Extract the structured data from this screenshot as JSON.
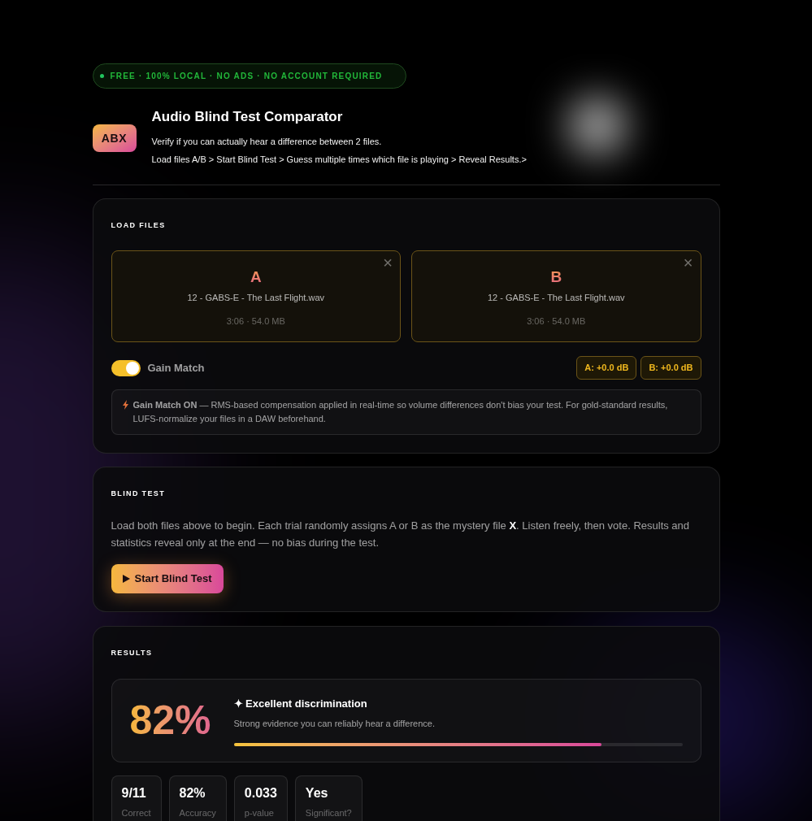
{
  "badge": {
    "text": "FREE · 100% LOCAL · NO ADS · NO ACCOUNT REQUIRED"
  },
  "header": {
    "logo": "ABX",
    "title": "Audio Blind Test Comparator",
    "subtitle": "Verify if you can actually hear a difference between 2 files.",
    "steps": "Load files A/B > Start Blind Test > Guess multiple times which file is playing > Reveal Results.>"
  },
  "load_files": {
    "heading": "LOAD FILES",
    "files": [
      {
        "letter": "A",
        "name": "12 - GABS-E - The Last Flight.wav",
        "meta": "3:06 · 54.0 MB",
        "close": "×"
      },
      {
        "letter": "B",
        "name": "12 - GABS-E - The Last Flight.wav",
        "meta": "3:06 · 54.0 MB",
        "close": "×"
      }
    ],
    "gain_match": {
      "label": "Gain Match",
      "on": true
    },
    "gains": [
      "A: +0.0 dB",
      "B: +0.0 dB"
    ],
    "note": "**Gain Match ON** — RMS-based compensation applied in real-time so volume differences don't bias your test. For gold-standard results, LUFS-normalize your files in a DAW beforehand."
  },
  "blind_test": {
    "heading": "BLIND TEST",
    "text": "Load both files above to begin. Each trial randomly assigns A or B as the mystery file **X**. Listen freely, then vote. Results and statistics reveal only at the end — no bias during the test.",
    "button": "Start Blind Test"
  },
  "results": {
    "heading": "RESULTS",
    "score": "82%",
    "verdict": "✦ Excellent discrimination",
    "detail": "Strong evidence you can reliably hear a difference.",
    "level": 0.82,
    "stats": [
      {
        "value": "9/11",
        "label": "Correct"
      },
      {
        "value": "82%",
        "label": "Accuracy"
      },
      {
        "value": "0.033",
        "label": "p-value"
      },
      {
        "value": "Yes",
        "label": "Significant?"
      }
    ]
  }
}
